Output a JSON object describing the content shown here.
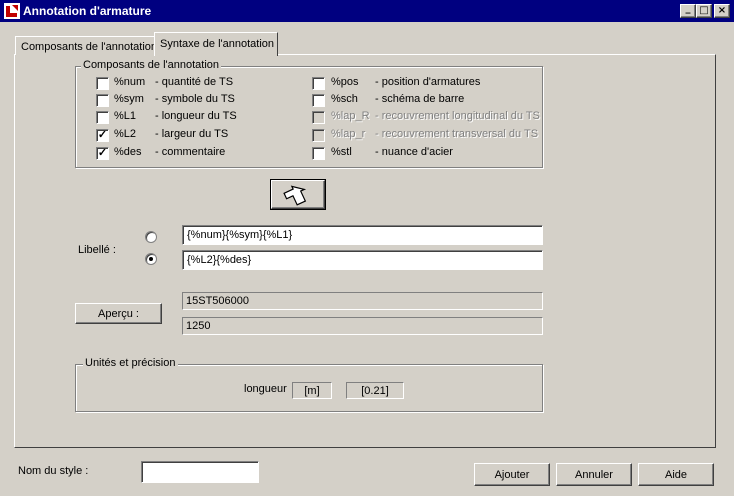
{
  "window": {
    "title": "Annotation d'armature",
    "minimize_glyph": "_",
    "maximize_glyph": "□",
    "close_glyph": "×"
  },
  "tabs": [
    {
      "label": "Composants de l'annotation",
      "active": false
    },
    {
      "label": "Syntaxe de l'annotation",
      "active": true
    }
  ],
  "components": {
    "legend": "Composants de l'annotation",
    "items": [
      {
        "code": "%num",
        "desc": "- quantité de TS",
        "checked": false,
        "enabled": true
      },
      {
        "code": "%sym",
        "desc": "- symbole du TS",
        "checked": false,
        "enabled": true
      },
      {
        "code": "%L1",
        "desc": "- longueur du TS",
        "checked": false,
        "enabled": true
      },
      {
        "code": "%L2",
        "desc": "- largeur du TS",
        "checked": true,
        "enabled": true
      },
      {
        "code": "%des",
        "desc": "- commentaire",
        "checked": true,
        "enabled": true
      },
      {
        "code": "%pos",
        "desc": "- position d'armatures",
        "checked": false,
        "enabled": true
      },
      {
        "code": "%sch",
        "desc": "- schéma de barre",
        "checked": false,
        "enabled": true
      },
      {
        "code": "%lap_R",
        "desc": "- recouvrement longitudinal du TS",
        "checked": false,
        "enabled": false
      },
      {
        "code": "%lap_r",
        "desc": "- recouvrement transversal du TS",
        "checked": false,
        "enabled": false
      },
      {
        "code": "%stl",
        "desc": "- nuance d'acier",
        "checked": false,
        "enabled": true
      }
    ],
    "checkmark": "✓"
  },
  "insert_button": {
    "icon": "insert-arrow-icon"
  },
  "libelle": {
    "label": "Libellé :",
    "line1": "{%num}{%sym}{%L1}",
    "line2": "{%L2}{%des}",
    "selected": 2
  },
  "apercu": {
    "button_label": "Aperçu :",
    "line1": "15ST506000",
    "line2": "1250"
  },
  "units": {
    "legend": "Unités et précision",
    "label": "longueur",
    "unit": "[m]",
    "precision": "[0.21]"
  },
  "footer": {
    "style_label": "Nom du style :",
    "style_value": "",
    "add_button": "Ajouter",
    "cancel_button": "Annuler",
    "help_button": "Aide"
  },
  "colors": {
    "titlebar": "#000080",
    "face": "#d4d0c8",
    "disabled_text": "#808080"
  }
}
